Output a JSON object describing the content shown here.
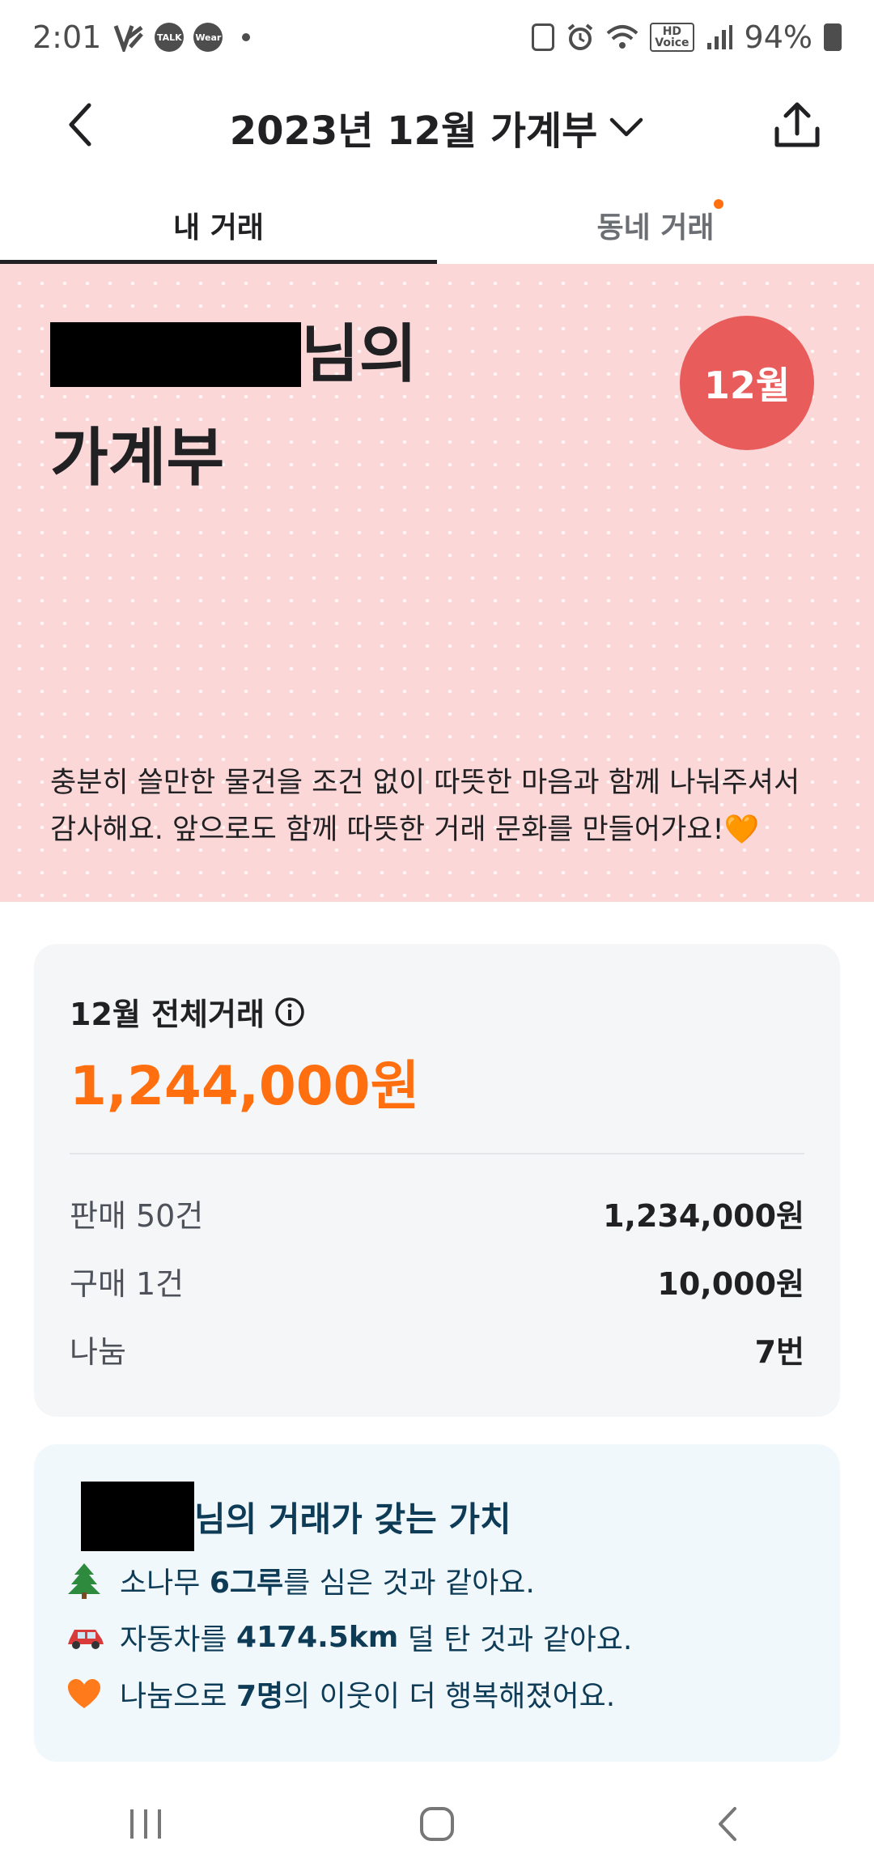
{
  "status_bar": {
    "time": "2:01",
    "icons": [
      "v-app-icon",
      "talk-icon",
      "wear-icon",
      "dot-icon",
      "card-icon",
      "alarm-icon",
      "wifi-icon",
      "hd-voice-icon",
      "signal-icon",
      "battery-icon"
    ],
    "talk_label": "TALK",
    "wear_label": "Wear",
    "hd_label": "HD",
    "voice_label": "Voice",
    "battery": "94%"
  },
  "header": {
    "title": "2023년 12월 가계부",
    "back_icon": "chevron-left-icon",
    "dropdown_icon": "chevron-down-icon",
    "share_icon": "share-icon"
  },
  "tabs": [
    {
      "label": "내 거래",
      "active": true
    },
    {
      "label": "동네 거래",
      "active": false,
      "has_dot": true
    }
  ],
  "hero": {
    "name_suffix": "님의",
    "title_line2": "가계부",
    "month_badge": "12월",
    "description": "충분히 쓸만한 물건을 조건 없이 따뜻한 마음과 함께 나눠주셔서 감사해요. 앞으로도 함께 따뜻한 거래 문화를 만들어가요!🧡",
    "background_color": "#fbd7d7",
    "badge_color": "#e85c5c"
  },
  "summary": {
    "title": "12월 전체거래",
    "info_icon": "info-icon",
    "total": "1,244,000원",
    "accent_color": "#ff6f0f",
    "rows": [
      {
        "label": "판매 50건",
        "value": "1,234,000원"
      },
      {
        "label": "구매 1건",
        "value": "10,000원"
      },
      {
        "label": "나눔",
        "value": "7번"
      }
    ]
  },
  "value_card": {
    "title_suffix": "님의 거래가 갖는 가치",
    "items": [
      {
        "emoji": "🌲",
        "pre": "소나무 ",
        "bold": "6그루",
        "post": "를 심은 것과 같아요."
      },
      {
        "emoji": "🚗",
        "pre": "자동차를 ",
        "bold": "4174.5km",
        "post": " 덜 탄 것과 같아요."
      },
      {
        "emoji": "🧡",
        "pre": "나눔으로 ",
        "bold": "7명",
        "post": "의 이웃이 더 행복해졌어요."
      }
    ]
  },
  "nav_bar": {
    "buttons": [
      "recent-apps-icon",
      "home-icon",
      "back-icon"
    ]
  }
}
